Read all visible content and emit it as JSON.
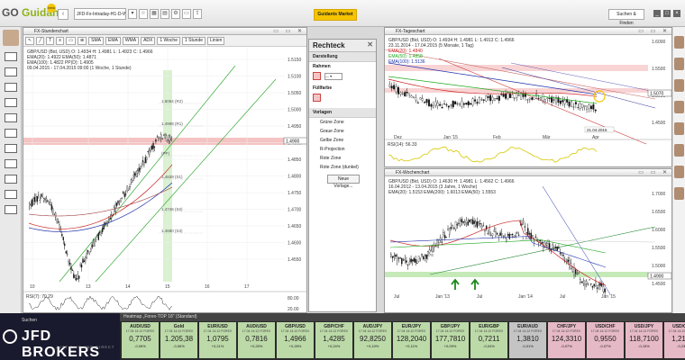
{
  "topbar": {
    "logo": "Guidants",
    "url": "JFD-Fx-Intraday-H1-D-W",
    "market_button": "Guidants Market",
    "search_button": "Suchen & Finden"
  },
  "chart_left": {
    "title": "FX-Stundenchart",
    "toolbar": [
      "SMA",
      "EMA",
      "WMA",
      "ADX",
      "1 Woche",
      "1 Stunde",
      "Linien"
    ],
    "header_lines": [
      "GBP/USD (Bid, USD) O: 1.4934 H: 1.4981 L: 1.4923 C: 1.4966",
      "EMA(20): 1.4922   EMA(50): 1.4871",
      "EMA(100): 1.4822   PP(D): 1.4905",
      "09.04.2015 - 17.04.2015 09:00 (1 Woche, 1 Stunde)"
    ],
    "pivot_labels": [
      "1.5064 (R2)",
      "1.4998 (R1)",
      "(PP)",
      "1.4839 (S1)",
      "1.4746 (S2)",
      "1.4680 (S3)"
    ],
    "y_ticks": [
      "1.5150",
      "1.5100",
      "1.5050",
      "1.5000",
      "1.4950",
      "1.4900",
      "1.4850",
      "1.4800",
      "1.4750",
      "1.4700",
      "1.4650",
      "1.4600",
      "1.4550"
    ],
    "x_ticks": [
      "10",
      "13",
      "14",
      "15",
      "16",
      "17"
    ],
    "price_marker": "1.4900",
    "rsi_label": "RSI(7): 70.29",
    "rsi_levels": [
      "80.00",
      "20.00"
    ]
  },
  "chart_daily": {
    "title": "FX-Tageschart",
    "header_lines": [
      "GBP/USD (Bid, USD) O: 1.4934 H: 1.4981 L: 1.4913 C: 1.4966",
      "23.11.2014 - 17.04.2015 (5 Monate, 1 Tag)",
      "EMA(20): 1.4840",
      "EMA(50): 1.4858",
      "EMA(100): 1.5136"
    ],
    "y_ticks": [
      "1.6000",
      "1.5500",
      "1.5000",
      "1.4500"
    ],
    "x_ticks": [
      "Dez",
      "Jan '15",
      "Feb",
      "Mär",
      "Apr"
    ],
    "date_marker": "21.04.2015",
    "price_marker": "1.5070",
    "osc_label": "RSI(14): 56.33"
  },
  "chart_weekly": {
    "title": "FX-Wochenchart",
    "header_lines": [
      "GBP/USD (Bid, USD) O: 1.4630 H: 1.4981 L: 1.4562 C: 1.4966",
      "16.04.2012 - 13.04.2015 (3 Jahre, 1 Woche)",
      "EMA(20): 1.5153   EMA(200): 1.6013   EMA(50): 1.5553"
    ],
    "y_ticks": [
      "1.7000",
      "1.6500",
      "1.6000",
      "1.5500",
      "1.5000",
      "1.4500"
    ],
    "x_ticks": [
      "Jul",
      "Jan '13",
      "Jul",
      "Jan '14",
      "Jul",
      "Jan '15"
    ],
    "level_label": "1.5395",
    "level_label2": "1.5078",
    "price_marker": "1.4900"
  },
  "tool_panel": {
    "title": "Rechteck",
    "section_display": "Darstellung",
    "label_frame": "Rahmen",
    "label_fill": "Füllfarbe",
    "section_templates": "Vorlagen",
    "templates": [
      "Grüne Zone",
      "Graue Zone",
      "Gelbe Zone",
      "R-Projection",
      "Rote Zone",
      "Rote Zone (dunkel)"
    ],
    "new_template": "Neue Vorlage..."
  },
  "ticker": {
    "header": "Heatmap „Forex-TOP 18“ (Standard)",
    "broker": "JFD BROKERS",
    "broker_tag": "JUST FAIR AND DIRECT",
    "tabs": "Suchen",
    "tiles": [
      {
        "sym": "AUD/USD",
        "date": "17.04 14:12 FOREX",
        "px": "0,7705",
        "chg": "-0,06%",
        "state": "up"
      },
      {
        "sym": "Gold",
        "date": "17.04 14:12 FOREX",
        "px": "1.205,38",
        "chg": "-0,06%",
        "state": "up"
      },
      {
        "sym": "EUR/USD",
        "date": "17.04 14:12 FOREX",
        "px": "1,0795",
        "chg": "+0,21%",
        "state": "up"
      },
      {
        "sym": "AUD/USD",
        "date": "17.04 14:12 FOREX",
        "px": "0,7816",
        "chg": "+0,25%",
        "state": "up"
      },
      {
        "sym": "GBP/USD",
        "date": "17.04 14:12 FOREX",
        "px": "1,4966",
        "chg": "+0,28%",
        "state": "up"
      },
      {
        "sym": "GBP/CHF",
        "date": "17.04 14:12 FOREX",
        "px": "1,4285",
        "chg": "+0,24%",
        "state": "up"
      },
      {
        "sym": "AUD/JPY",
        "date": "17.04 14:12 FOREX",
        "px": "92,8250",
        "chg": "+0,19%",
        "state": "up"
      },
      {
        "sym": "EUR/JPY",
        "date": "17.04 14:12 FOREX",
        "px": "128,2040",
        "chg": "+0,11%",
        "state": "up"
      },
      {
        "sym": "GBP/JPY",
        "date": "17.04 14:12 FOREX",
        "px": "177,7810",
        "chg": "+0,09%",
        "state": "up"
      },
      {
        "sym": "EUR/GBP",
        "date": "17.04 14:12 FOREX",
        "px": "0,7211",
        "chg": "-0,04%",
        "state": "up"
      },
      {
        "sym": "EUR/AUD",
        "date": "17.04 14:12 FOREX",
        "px": "1,3810",
        "chg": "-0,01%",
        "state": "dim"
      },
      {
        "sym": "CHF/JPY",
        "date": "17.04 14:12 FOREX",
        "px": "124,3310",
        "chg": "-0,07%",
        "state": "down"
      },
      {
        "sym": "USD/CHF",
        "date": "17.04 14:12 FOREX",
        "px": "0,9550",
        "chg": "-0,07%",
        "state": "down"
      },
      {
        "sym": "USD/JPY",
        "date": "17.04 14:12 FOREX",
        "px": "118,7100",
        "chg": "-0,15%",
        "state": "down"
      },
      {
        "sym": "USD/CAD",
        "date": "17.04 14:12 FOREX",
        "px": "1,2166",
        "chg": "-0,23%",
        "state": "down"
      }
    ]
  },
  "colors": {
    "ema_red": "#cc2222",
    "ema_blue": "#2233aa",
    "ema_green": "#22aa22",
    "zone_red": "#f3b8b8",
    "zone_green": "#bfe8b0",
    "rsi_yellow": "#d6c800",
    "accent_yellow": "#f5c400"
  }
}
